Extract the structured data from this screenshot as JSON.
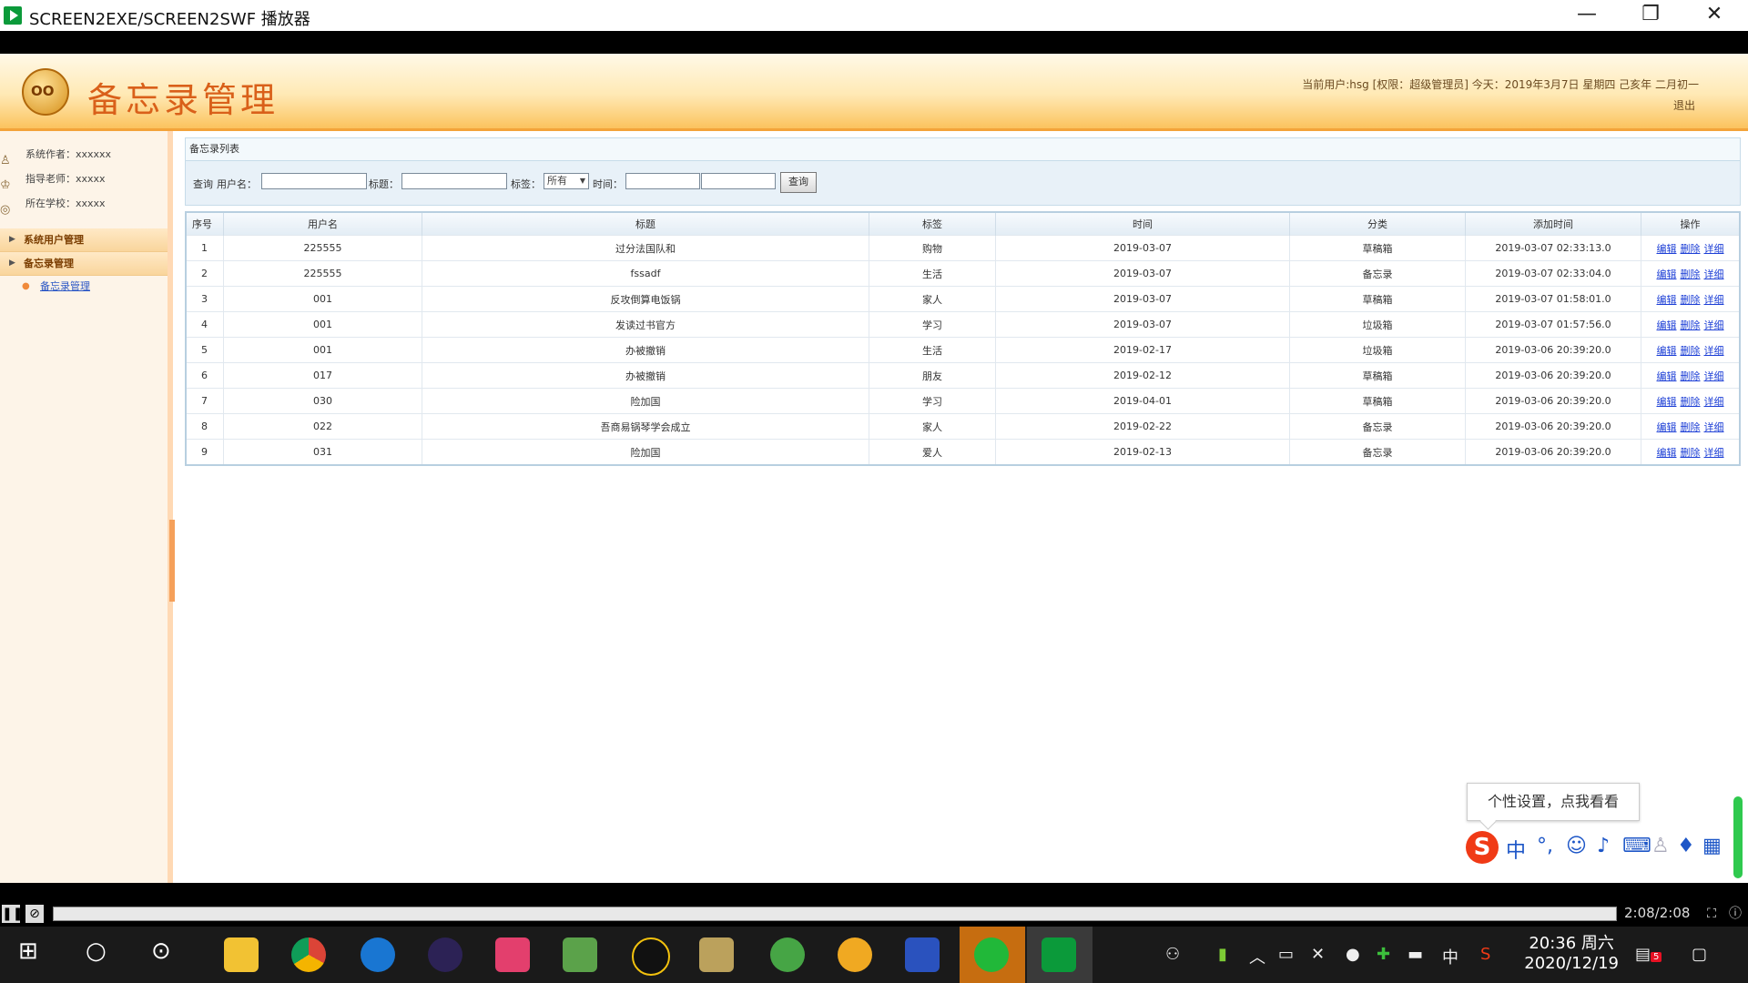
{
  "window": {
    "title": "SCREEN2EXE/SCREEN2SWF 播放器",
    "minimize": "—",
    "restore": "❐",
    "close": "✕"
  },
  "header": {
    "logo_text": "OO",
    "title": "备忘录管理",
    "user_info": "当前用户:hsg [权限：超级管理员] 今天：2019年3月7日 星期四 己亥年 二月初一",
    "logout": "退出"
  },
  "sidebar": {
    "info": [
      {
        "icon": "person-icon",
        "glyph": "♙",
        "text": "系统作者：xxxxxx"
      },
      {
        "icon": "teacher-icon",
        "glyph": "♔",
        "text": "指导老师：xxxxx"
      },
      {
        "icon": "school-icon",
        "glyph": "◎",
        "text": "所在学校：xxxxx"
      }
    ],
    "menus": [
      {
        "label": "系统用户管理"
      },
      {
        "label": "备忘录管理"
      }
    ],
    "sub_item": "备忘录管理"
  },
  "main": {
    "panel_title": "备忘录列表",
    "search": {
      "prefix": "查询",
      "username_label": "用户名：",
      "title_label": "标题：",
      "tag_label": "标签：",
      "tag_selected": "所有",
      "time_label": "时间：",
      "button": "查询"
    },
    "columns": [
      "序号",
      "用户名",
      "标题",
      "标签",
      "时间",
      "分类",
      "添加时间",
      "操作"
    ],
    "ops": [
      "编辑",
      "删除",
      "详细"
    ],
    "rows": [
      [
        "1",
        "225555",
        "过分法国队和",
        "购物",
        "2019-03-07",
        "草稿箱",
        "2019-03-07 02:33:13.0"
      ],
      [
        "2",
        "225555",
        "fssadf",
        "生活",
        "2019-03-07",
        "备忘录",
        "2019-03-07 02:33:04.0"
      ],
      [
        "3",
        "001",
        "反攻倒算电饭锅",
        "家人",
        "2019-03-07",
        "草稿箱",
        "2019-03-07 01:58:01.0"
      ],
      [
        "4",
        "001",
        "发读过书官方",
        "学习",
        "2019-03-07",
        "垃圾箱",
        "2019-03-07 01:57:56.0"
      ],
      [
        "5",
        "001",
        "办被撤销",
        "生活",
        "2019-02-17",
        "垃圾箱",
        "2019-03-06 20:39:20.0"
      ],
      [
        "6",
        "017",
        "办被撤销",
        "朋友",
        "2019-02-12",
        "草稿箱",
        "2019-03-06 20:39:20.0"
      ],
      [
        "7",
        "030",
        "险加国",
        "学习",
        "2019-04-01",
        "草稿箱",
        "2019-03-06 20:39:20.0"
      ],
      [
        "8",
        "022",
        "吾商易锅琴学会成立",
        "家人",
        "2019-02-22",
        "备忘录",
        "2019-03-06 20:39:20.0"
      ],
      [
        "9",
        "031",
        "险加国",
        "爱人",
        "2019-02-13",
        "备忘录",
        "2019-03-06 20:39:20.0"
      ]
    ]
  },
  "ime": {
    "tooltip": "个性设置，点我看看",
    "logo": "S",
    "zh": "中",
    "punct": "°,",
    "emoji": "☺",
    "mic": "♪",
    "keyboard": "⌨",
    "user": "♙",
    "skin": "♦",
    "grid": "▦"
  },
  "player": {
    "pause": "❚❚",
    "stop": "⊘",
    "time": "2:08/2:08",
    "fullscreen": "⛶",
    "info": "ⓘ"
  },
  "taskbar": {
    "start": "⊞",
    "search": "○",
    "clock_time": "20:36 周六",
    "clock_date": "2020/12/19",
    "tray_lang": "中",
    "notif_count": "5"
  }
}
